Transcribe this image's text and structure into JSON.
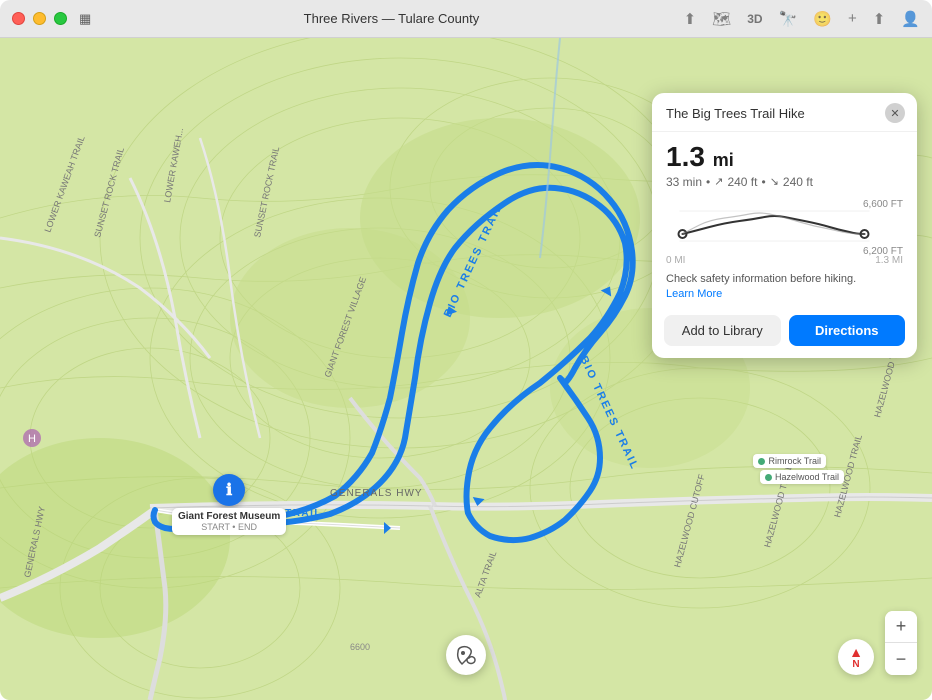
{
  "window": {
    "title": "Three Rivers — Tulare County"
  },
  "titlebar": {
    "controls": [
      "compass-icon",
      "map-icon",
      "3d-label",
      "binoculars-icon",
      "smiley-icon",
      "plus-icon",
      "share-icon",
      "account-icon"
    ]
  },
  "card": {
    "title": "The Big Trees Trail Hike",
    "distance": "1.3",
    "distance_unit": "mi",
    "duration": "33 min",
    "elevation_gain": "240 ft",
    "elevation_loss": "240 ft",
    "elev_high_label": "6,600 FT",
    "elev_low_label": "6,200 FT",
    "x_start_label": "0 MI",
    "x_end_label": "1.3 MI",
    "safety_text": "Check safety information before hiking.",
    "learn_more_text": "Learn More",
    "add_to_library_label": "Add to Library",
    "directions_label": "Directions"
  },
  "map": {
    "museum_name": "Giant Forest Museum",
    "museum_sub": "START • END",
    "trails": [
      {
        "name": "Rimrock Trail"
      },
      {
        "name": "Hazelwood Trail"
      }
    ]
  },
  "controls": {
    "zoom_in": "+",
    "zoom_out": "−",
    "compass": "N"
  }
}
